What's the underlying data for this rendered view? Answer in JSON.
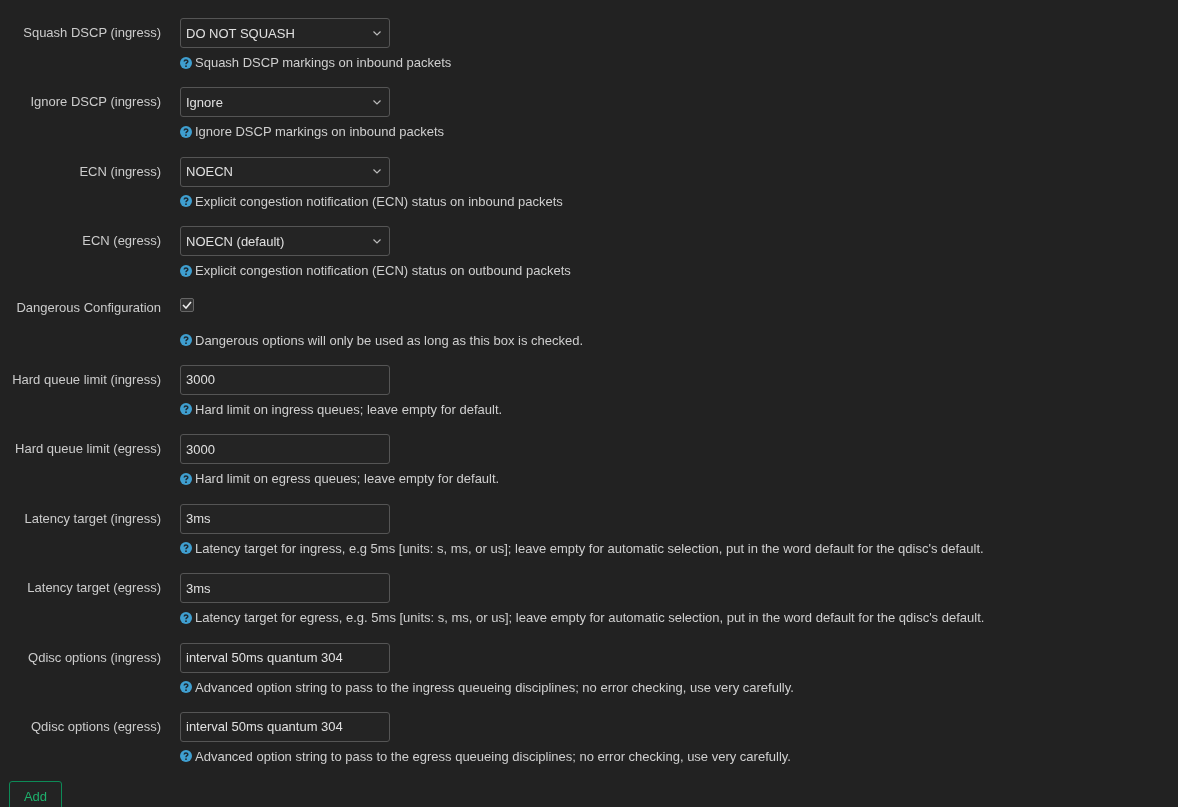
{
  "fields": [
    {
      "kind": "select",
      "label": "Squash DSCP (ingress)",
      "value": "DO NOT SQUASH",
      "help": "Squash DSCP markings on inbound packets"
    },
    {
      "kind": "select",
      "label": "Ignore DSCP (ingress)",
      "value": "Ignore",
      "help": "Ignore DSCP markings on inbound packets"
    },
    {
      "kind": "select",
      "label": "ECN (ingress)",
      "value": "NOECN",
      "help": "Explicit congestion notification (ECN) status on inbound packets"
    },
    {
      "kind": "select",
      "label": "ECN (egress)",
      "value": "NOECN (default)",
      "help": "Explicit congestion notification (ECN) status on outbound packets"
    },
    {
      "kind": "checkbox",
      "label": "Dangerous Configuration",
      "checked": true,
      "help": "Dangerous options will only be used as long as this box is checked."
    },
    {
      "kind": "text",
      "label": "Hard queue limit (ingress)",
      "value": "3000",
      "help": "Hard limit on ingress queues; leave empty for default."
    },
    {
      "kind": "text",
      "label": "Hard queue limit (egress)",
      "value": "3000",
      "help": "Hard limit on egress queues; leave empty for default."
    },
    {
      "kind": "text",
      "label": "Latency target (ingress)",
      "value": "3ms",
      "help": "Latency target for ingress, e.g 5ms [units: s, ms, or us]; leave empty for automatic selection, put in the word default for the qdisc's default."
    },
    {
      "kind": "text",
      "label": "Latency target (egress)",
      "value": "3ms",
      "help": "Latency target for egress, e.g. 5ms [units: s, ms, or us]; leave empty for automatic selection, put in the word default for the qdisc's default."
    },
    {
      "kind": "text",
      "label": "Qdisc options (ingress)",
      "value": "interval 50ms quantum 304",
      "help": "Advanced option string to pass to the ingress queueing disciplines; no error checking, use very carefully."
    },
    {
      "kind": "text",
      "label": "Qdisc options (egress)",
      "value": "interval 50ms quantum 304",
      "help": "Advanced option string to pass to the egress queueing disciplines; no error checking, use very carefully."
    }
  ],
  "add_button": "Add"
}
